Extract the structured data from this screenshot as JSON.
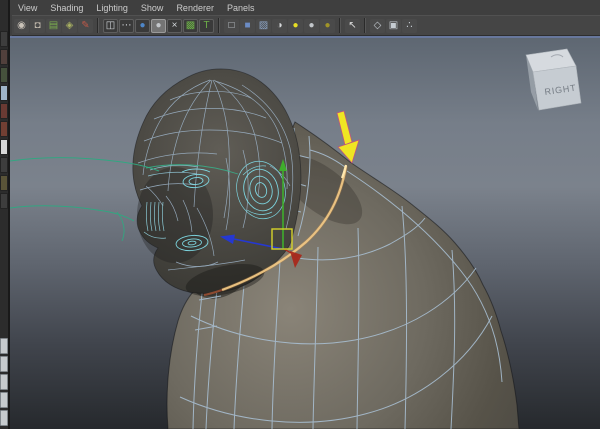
{
  "menu_bar": {
    "items": [
      "View",
      "Shading",
      "Lighting",
      "Show",
      "Renderer",
      "Panels"
    ]
  },
  "panel_toolbar": {
    "groups": [
      {
        "icons": [
          {
            "name": "select-camera-icon",
            "glyph": "◉",
            "style": "color:#c9c2b8"
          },
          {
            "name": "camera-attributes-icon",
            "glyph": "◘",
            "style": "color:#c0b8ac"
          },
          {
            "name": "bookmarks-icon",
            "glyph": "▤",
            "style": "color:#7cb04e"
          },
          {
            "name": "image-plane-icon",
            "glyph": "◈",
            "style": "color:#a8b062"
          },
          {
            "name": "grease-pencil-icon",
            "glyph": "✎",
            "style": "color:#c05848"
          }
        ]
      },
      {
        "icons": [
          {
            "name": "resolution-gate-icon",
            "glyph": "◫",
            "style": "color:#d0d4d8"
          },
          {
            "name": "film-gate-icon",
            "glyph": "⋯",
            "style": "color:#d0d4d8"
          },
          {
            "name": "smooth-shade-icon",
            "glyph": "●",
            "style": "color:#4e86c8"
          },
          {
            "name": "flat-shade-icon",
            "glyph": "●",
            "style": "color:#c2c6ca"
          },
          {
            "name": "x-ray-icon",
            "glyph": "×",
            "style": "color:#d0d4d8"
          },
          {
            "name": "textured-icon",
            "glyph": "▩",
            "style": "color:#6cae48"
          },
          {
            "name": "texture-borders-icon",
            "glyph": "T",
            "style": "color:#6cae48"
          }
        ]
      },
      {
        "icons": [
          {
            "name": "wireframe-display-icon",
            "glyph": "□",
            "style": "color:#c6ccd2"
          },
          {
            "name": "shaded-display-icon",
            "glyph": "■",
            "style": "color:#6c8cc4"
          },
          {
            "name": "xray-display-icon",
            "glyph": "▨",
            "style": "color:#8ea6c8"
          },
          {
            "name": "default-material-icon",
            "glyph": "◑",
            "style": "color:#d6d8da"
          },
          {
            "name": "all-lights-icon",
            "glyph": "●",
            "style": "color:#e6de24"
          },
          {
            "name": "no-lights-icon",
            "glyph": "●",
            "style": "color:#c2c6ca"
          },
          {
            "name": "selected-lights-icon",
            "glyph": "●",
            "style": "color:#a09428"
          }
        ]
      },
      {
        "icons": [
          {
            "name": "isolate-select-icon",
            "glyph": "↖",
            "style": "color:#dcdcdc"
          }
        ]
      },
      {
        "icons": [
          {
            "name": "poly-cage-display-icon",
            "glyph": "◇",
            "style": "color:#c6ccd2"
          },
          {
            "name": "display-planes-icon",
            "glyph": "▣",
            "style": "color:#c6ccd2"
          },
          {
            "name": "node-links-icon",
            "glyph": "∴",
            "style": "color:#c6ccd2"
          }
        ]
      }
    ]
  },
  "left_toolbox": {
    "tool_buttons": [
      {
        "name": "select-tool-button",
        "style": "background:#3d3d3d"
      },
      {
        "name": "lasso-tool-button",
        "style": "background:#51403c"
      },
      {
        "name": "paint-select-tool-button",
        "style": "background:#45513c"
      },
      {
        "name": "move-tool-button",
        "style": "background:#9fb4c8"
      },
      {
        "name": "rotate-tool-button",
        "style": "background:#6a3a33"
      },
      {
        "name": "scale-tool-button",
        "style": "background:#713f33"
      },
      {
        "name": "universal-manip-button",
        "style": "background:#d8d8d8"
      },
      {
        "name": "soft-mod-tool-button",
        "style": "background:#3d3d3d"
      },
      {
        "name": "show-manip-tool-button",
        "style": "background:#5a5438"
      },
      {
        "name": "last-tool-button",
        "style": "background:#3d3d3d"
      }
    ],
    "layout_buttons": [
      {
        "name": "layout-single-pane-button",
        "style": "background:#c6cacd"
      },
      {
        "name": "layout-four-pane-button",
        "style": "background:#c6cacd"
      },
      {
        "name": "layout-persp-outliner-button",
        "style": "background:#c6cacd"
      },
      {
        "name": "layout-hypergraph-button",
        "style": "background:#c6cacd"
      },
      {
        "name": "layout-custom-button",
        "style": "background:#c6cacd"
      }
    ]
  },
  "viewport": {
    "view_cube": {
      "front_label": "RIGHT"
    },
    "colors": {
      "background_top": "#5e6772",
      "background_bottom": "#26292d",
      "wireframe": "#a9c0d4",
      "highlight_wireframe": "#7fdbe6",
      "selected_edge_loop": "#eec684",
      "annotation_arrow": "#f3ea20",
      "construction_curve": "#2fa981",
      "manipulator_x": "#aa2517",
      "manipulator_y": "#3fae2c",
      "manipulator_z": "#2538d2",
      "manipulator_center": "#d6d32a"
    }
  }
}
